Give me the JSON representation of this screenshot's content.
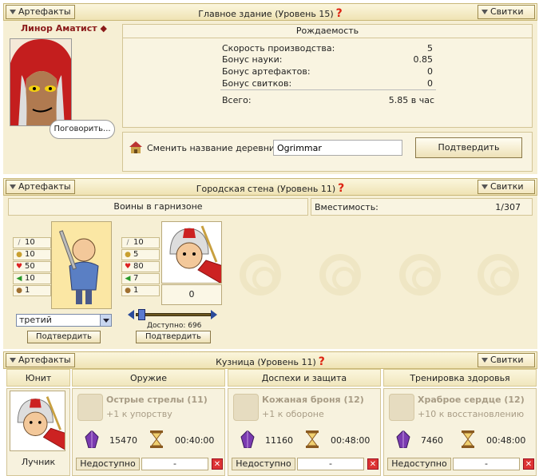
{
  "main_building": {
    "header_left": "Артефакты",
    "title": "Главное здание (Уровень 15)",
    "header_right": "Свитки",
    "hero_name": "Линор Аматист ◆",
    "talk_label": "Поговорить...",
    "production_title": "Рождаемость",
    "rows": [
      {
        "label": "Скорость производства:",
        "value": "5"
      },
      {
        "label": "Бонус науки:",
        "value": "0.85"
      },
      {
        "label": "Бонус артефактов:",
        "value": "0"
      },
      {
        "label": "Бонус свитков:",
        "value": "0"
      }
    ],
    "total_label": "Всего:",
    "total_value": "5.85 в час",
    "rename_label": "Сменить название деревни:",
    "rename_value": "Ogrimmar",
    "confirm_label": "Подтвердить"
  },
  "city_wall": {
    "header_left": "Артефакты",
    "title": "Городская стена (Уровень 11)",
    "header_right": "Свитки",
    "garrison_label": "Воины в гарнизоне",
    "capacity_label": "Вместимость:",
    "capacity_value": "1/307",
    "unit1_stats": [
      "10",
      "10",
      "50",
      "10",
      "1"
    ],
    "unit2_stats": [
      "10",
      "5",
      "80",
      "7",
      "1"
    ],
    "unit2_count": "0",
    "select_value": "третий",
    "available_label": "Доступно: 696",
    "confirm1": "Подтвердить",
    "confirm2": "Подтвердить",
    "slider_fraction": 0.03
  },
  "forge": {
    "header_left": "Артефакты",
    "title": "Кузница (Уровень 11)",
    "header_right": "Свитки",
    "columns": [
      "Юнит",
      "Оружие",
      "Доспехи и защита",
      "Тренировка здоровья"
    ],
    "unit_name": "Лучник",
    "cards": [
      {
        "title": "Острые стрелы (11)",
        "sub": "+1 к упорству",
        "cost": "15470",
        "time": "00:40:00",
        "status": "Недоступно",
        "dash": "-"
      },
      {
        "title": "Кожаная броня (12)",
        "sub": "+1 к обороне",
        "cost": "11160",
        "time": "00:48:00",
        "status": "Недоступно",
        "dash": "-"
      },
      {
        "title": "Храброе сердце (12)",
        "sub": "+10 к восстановлению",
        "cost": "7460",
        "time": "00:48:00",
        "status": "Недоступно",
        "dash": "-"
      }
    ]
  },
  "colors": {
    "header_bg": "#efe3b4",
    "accent_red": "#d21",
    "plus_green": "#2a9a2a"
  }
}
